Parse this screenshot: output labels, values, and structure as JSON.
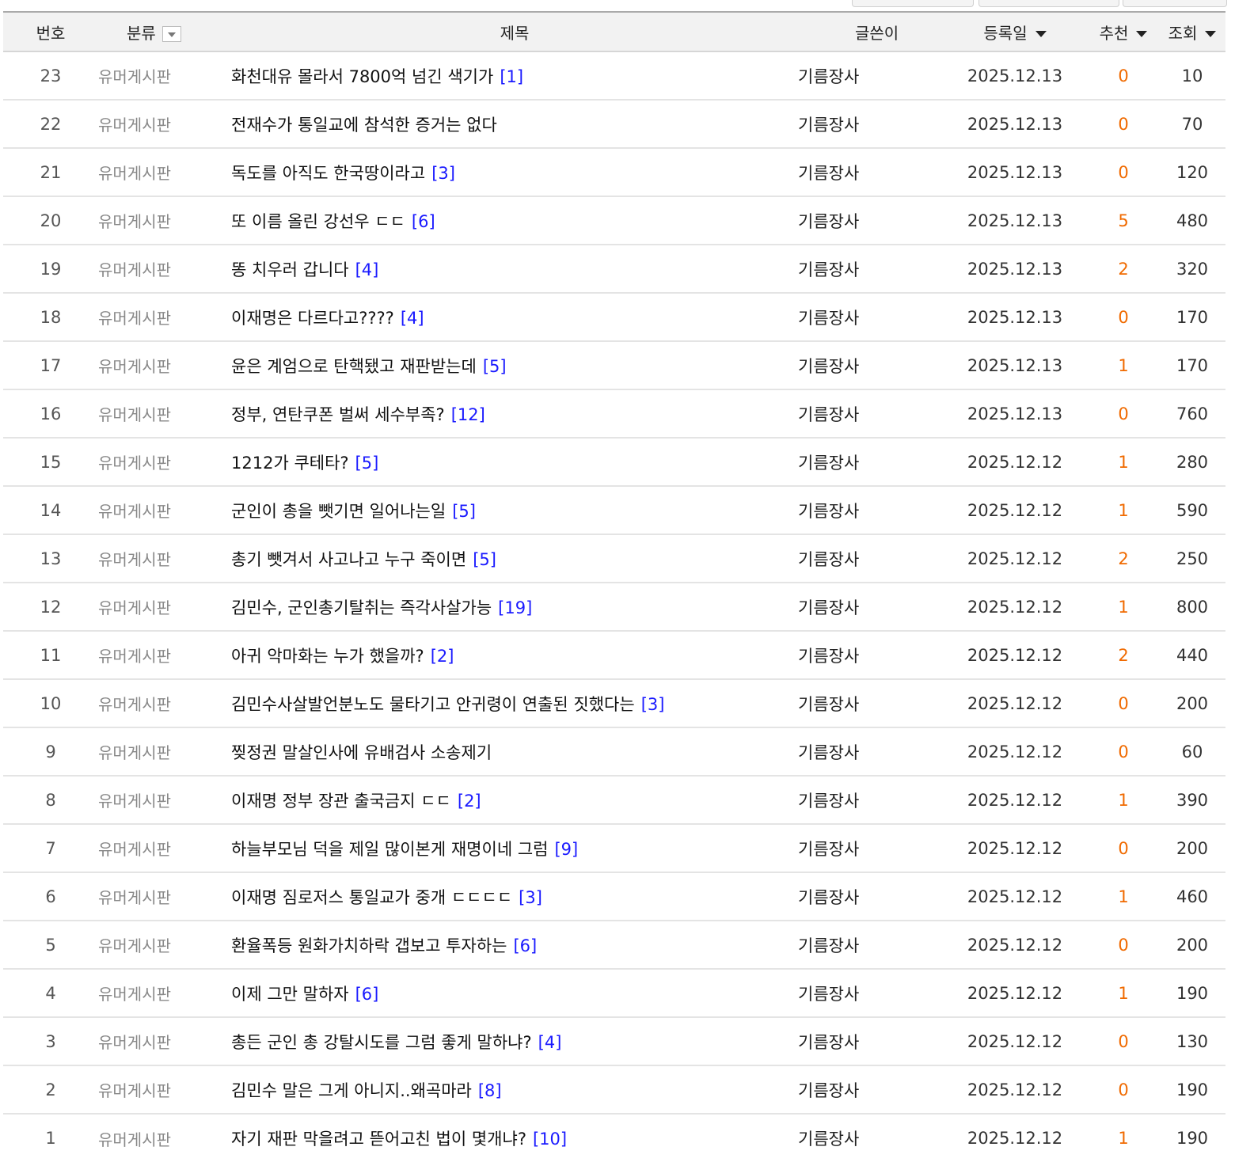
{
  "header": {
    "num": "번호",
    "category": "분류",
    "title": "제목",
    "writer": "글쓴이",
    "date": "등록일",
    "recommend": "추천",
    "views": "조회"
  },
  "posts": [
    {
      "num": "23",
      "category": "유머게시판",
      "title": "화천대유 몰라서 7800억 넘긴 색기가",
      "comments": "[1]",
      "writer": "기름장사",
      "date": "2025.12.13",
      "recommend": "0",
      "views": "10"
    },
    {
      "num": "22",
      "category": "유머게시판",
      "title": "전재수가 통일교에 참석한 증거는 없다",
      "comments": "",
      "writer": "기름장사",
      "date": "2025.12.13",
      "recommend": "0",
      "views": "70"
    },
    {
      "num": "21",
      "category": "유머게시판",
      "title": "독도를 아직도 한국땅이라고",
      "comments": "[3]",
      "writer": "기름장사",
      "date": "2025.12.13",
      "recommend": "0",
      "views": "120"
    },
    {
      "num": "20",
      "category": "유머게시판",
      "title": "또 이름 올린 강선우 ㄷㄷ",
      "comments": "[6]",
      "writer": "기름장사",
      "date": "2025.12.13",
      "recommend": "5",
      "views": "480"
    },
    {
      "num": "19",
      "category": "유머게시판",
      "title": "똥 치우러 갑니다",
      "comments": "[4]",
      "writer": "기름장사",
      "date": "2025.12.13",
      "recommend": "2",
      "views": "320"
    },
    {
      "num": "18",
      "category": "유머게시판",
      "title": "이재명은 다르다고????",
      "comments": "[4]",
      "writer": "기름장사",
      "date": "2025.12.13",
      "recommend": "0",
      "views": "170"
    },
    {
      "num": "17",
      "category": "유머게시판",
      "title": "윤은 계엄으로 탄핵됐고 재판받는데",
      "comments": "[5]",
      "writer": "기름장사",
      "date": "2025.12.13",
      "recommend": "1",
      "views": "170"
    },
    {
      "num": "16",
      "category": "유머게시판",
      "title": "정부, 연탄쿠폰 벌써 세수부족?",
      "comments": "[12]",
      "writer": "기름장사",
      "date": "2025.12.13",
      "recommend": "0",
      "views": "760"
    },
    {
      "num": "15",
      "category": "유머게시판",
      "title": "1212가 쿠테타?",
      "comments": "[5]",
      "writer": "기름장사",
      "date": "2025.12.12",
      "recommend": "1",
      "views": "280"
    },
    {
      "num": "14",
      "category": "유머게시판",
      "title": "군인이 총을 뺏기면 일어나는일",
      "comments": "[5]",
      "writer": "기름장사",
      "date": "2025.12.12",
      "recommend": "1",
      "views": "590"
    },
    {
      "num": "13",
      "category": "유머게시판",
      "title": "총기 뺏겨서 사고나고 누구 죽이면",
      "comments": "[5]",
      "writer": "기름장사",
      "date": "2025.12.12",
      "recommend": "2",
      "views": "250"
    },
    {
      "num": "12",
      "category": "유머게시판",
      "title": "김민수, 군인총기탈취는 즉각사살가능",
      "comments": "[19]",
      "writer": "기름장사",
      "date": "2025.12.12",
      "recommend": "1",
      "views": "800"
    },
    {
      "num": "11",
      "category": "유머게시판",
      "title": "아귀 악마화는 누가 했을까?",
      "comments": "[2]",
      "writer": "기름장사",
      "date": "2025.12.12",
      "recommend": "2",
      "views": "440"
    },
    {
      "num": "10",
      "category": "유머게시판",
      "title": "김민수사살발언분노도 물타기고 안귀령이 연출된 짓했다는",
      "comments": "[3]",
      "writer": "기름장사",
      "date": "2025.12.12",
      "recommend": "0",
      "views": "200"
    },
    {
      "num": "9",
      "category": "유머게시판",
      "title": "찢정권 말살인사에 유배검사 소송제기",
      "comments": "",
      "writer": "기름장사",
      "date": "2025.12.12",
      "recommend": "0",
      "views": "60"
    },
    {
      "num": "8",
      "category": "유머게시판",
      "title": "이재명 정부 장관 출국금지 ㄷㄷ",
      "comments": "[2]",
      "writer": "기름장사",
      "date": "2025.12.12",
      "recommend": "1",
      "views": "390"
    },
    {
      "num": "7",
      "category": "유머게시판",
      "title": "하늘부모님 덕을 제일 많이본게 재명이네 그럼",
      "comments": "[9]",
      "writer": "기름장사",
      "date": "2025.12.12",
      "recommend": "0",
      "views": "200"
    },
    {
      "num": "6",
      "category": "유머게시판",
      "title": "이재명 짐로저스 통일교가 중개 ㄷㄷㄷㄷ",
      "comments": "[3]",
      "writer": "기름장사",
      "date": "2025.12.12",
      "recommend": "1",
      "views": "460"
    },
    {
      "num": "5",
      "category": "유머게시판",
      "title": "환율폭등 원화가치하락 갭보고 투자하는",
      "comments": "[6]",
      "writer": "기름장사",
      "date": "2025.12.12",
      "recommend": "0",
      "views": "200"
    },
    {
      "num": "4",
      "category": "유머게시판",
      "title": "이제 그만 말하자",
      "comments": "[6]",
      "writer": "기름장사",
      "date": "2025.12.12",
      "recommend": "1",
      "views": "190"
    },
    {
      "num": "3",
      "category": "유머게시판",
      "title": "총든 군인 총 강탈시도를 그럼 좋게 말하냐?",
      "comments": "[4]",
      "writer": "기름장사",
      "date": "2025.12.12",
      "recommend": "0",
      "views": "130"
    },
    {
      "num": "2",
      "category": "유머게시판",
      "title": "김민수 말은 그게 아니지..왜곡마라",
      "comments": "[8]",
      "writer": "기름장사",
      "date": "2025.12.12",
      "recommend": "0",
      "views": "190"
    },
    {
      "num": "1",
      "category": "유머게시판",
      "title": "자기 재판 막을려고 뜯어고친 법이 몇개냐?",
      "comments": "[10]",
      "writer": "기름장사",
      "date": "2025.12.12",
      "recommend": "1",
      "views": "190"
    }
  ]
}
